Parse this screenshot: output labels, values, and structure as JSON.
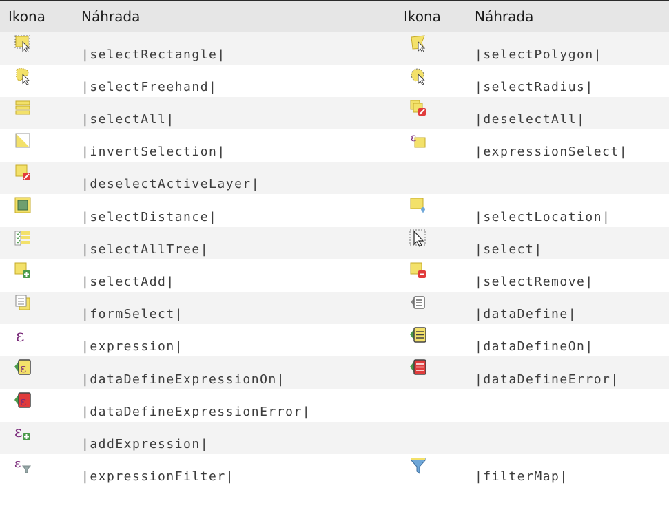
{
  "header": {
    "col_icon": "Ikona",
    "col_sub": "Náhrada"
  },
  "colors": {
    "yellow": "#f3e16a",
    "yellow_stroke": "#c6ab2a",
    "red": "#e03b3b",
    "green": "#4a9a4a",
    "purple": "#7a2a7a",
    "blue": "#6fa7d8"
  },
  "rows": [
    {
      "left": {
        "icon": "select-rectangle-icon",
        "text": "|selectRectangle|"
      },
      "right": {
        "icon": "select-polygon-icon",
        "text": "|selectPolygon|"
      }
    },
    {
      "left": {
        "icon": "select-freehand-icon",
        "text": "|selectFreehand|"
      },
      "right": {
        "icon": "select-radius-icon",
        "text": "|selectRadius|"
      }
    },
    {
      "left": {
        "icon": "select-all-icon",
        "text": "|selectAll|"
      },
      "right": {
        "icon": "deselect-all-icon",
        "text": "|deselectAll|"
      }
    },
    {
      "left": {
        "icon": "invert-selection-icon",
        "text": "|invertSelection|"
      },
      "right": {
        "icon": "expression-select-icon",
        "text": "|expressionSelect|"
      }
    },
    {
      "left": {
        "icon": "deselect-active-layer-icon",
        "text": "|deselectActiveLayer|"
      },
      "right": {
        "icon": "",
        "text": ""
      }
    },
    {
      "left": {
        "icon": "select-distance-icon",
        "text": "|selectDistance|"
      },
      "right": {
        "icon": "select-location-icon",
        "text": "|selectLocation|"
      }
    },
    {
      "left": {
        "icon": "select-all-tree-icon",
        "text": "|selectAllTree|"
      },
      "right": {
        "icon": "select-cursor-icon",
        "text": "|select|"
      }
    },
    {
      "left": {
        "icon": "select-add-icon",
        "text": "|selectAdd|"
      },
      "right": {
        "icon": "select-remove-icon",
        "text": "|selectRemove|"
      }
    },
    {
      "left": {
        "icon": "form-select-icon",
        "text": "|formSelect|"
      },
      "right": {
        "icon": "data-define-icon",
        "text": "|dataDefine|"
      }
    },
    {
      "left": {
        "icon": "expression-icon",
        "text": "|expression|"
      },
      "right": {
        "icon": "data-define-on-icon",
        "text": "|dataDefineOn|"
      }
    },
    {
      "left": {
        "icon": "data-define-expression-on-icon",
        "text": "|dataDefineExpressionOn|"
      },
      "right": {
        "icon": "data-define-error-icon",
        "text": "|dataDefineError|"
      }
    },
    {
      "left": {
        "icon": "data-define-expression-error-icon",
        "text": "|dataDefineExpressionError|"
      },
      "right": {
        "icon": "",
        "text": ""
      }
    },
    {
      "left": {
        "icon": "add-expression-icon",
        "text": "|addExpression|"
      },
      "right": {
        "icon": "",
        "text": ""
      }
    },
    {
      "left": {
        "icon": "expression-filter-icon",
        "text": "|expressionFilter|"
      },
      "right": {
        "icon": "filter-map-icon",
        "text": "|filterMap|"
      }
    }
  ]
}
